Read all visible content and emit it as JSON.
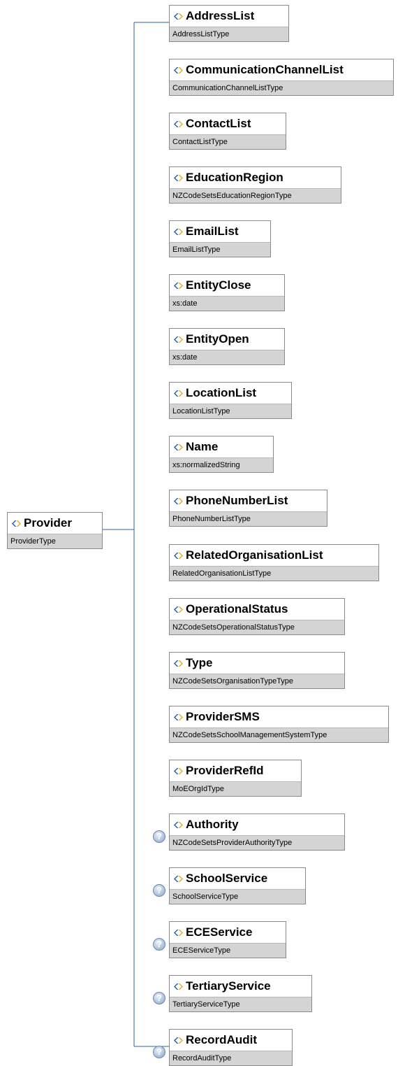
{
  "root": {
    "name": "Provider",
    "type": "ProviderType"
  },
  "children": [
    {
      "name": "AddressList",
      "type": "AddressListType",
      "optional": false
    },
    {
      "name": "CommunicationChannelList",
      "type": "CommunicationChannelListType",
      "optional": false
    },
    {
      "name": "ContactList",
      "type": "ContactListType",
      "optional": false
    },
    {
      "name": "EducationRegion",
      "type": "NZCodeSetsEducationRegionType",
      "optional": false
    },
    {
      "name": "EmailList",
      "type": "EmailListType",
      "optional": false
    },
    {
      "name": "EntityClose",
      "type": "xs:date",
      "optional": false
    },
    {
      "name": "EntityOpen",
      "type": "xs:date",
      "optional": false
    },
    {
      "name": "LocationList",
      "type": "LocationListType",
      "optional": false
    },
    {
      "name": "Name",
      "type": "xs:normalizedString",
      "optional": false
    },
    {
      "name": "PhoneNumberList",
      "type": "PhoneNumberListType",
      "optional": false
    },
    {
      "name": "RelatedOrganisationList",
      "type": "RelatedOrganisationListType",
      "optional": false
    },
    {
      "name": "OperationalStatus",
      "type": "NZCodeSetsOperationalStatusType",
      "optional": false
    },
    {
      "name": "Type",
      "type": "NZCodeSetsOrganisationTypeType",
      "optional": false
    },
    {
      "name": "ProviderSMS",
      "type": "NZCodeSetsSchoolManagementSystemType",
      "optional": false
    },
    {
      "name": "ProviderRefId",
      "type": "MoEOrgIdType",
      "optional": false
    },
    {
      "name": "Authority",
      "type": "NZCodeSetsProviderAuthorityType",
      "optional": true
    },
    {
      "name": "SchoolService",
      "type": "SchoolServiceType",
      "optional": true
    },
    {
      "name": "ECEService",
      "type": "ECEServiceType",
      "optional": true
    },
    {
      "name": "TertiaryService",
      "type": "TertiaryServiceType",
      "optional": true
    },
    {
      "name": "RecordAudit",
      "type": "RecordAuditType",
      "optional": true
    }
  ],
  "optional_symbol": "?",
  "colors": {
    "connector": "#2f5f9e",
    "icon_blue": "#1f5fb0",
    "icon_gold": "#e0b020",
    "type_bar": "#d4d4d4"
  },
  "icons": {
    "element": "element-icon",
    "optional": "optional-icon"
  }
}
